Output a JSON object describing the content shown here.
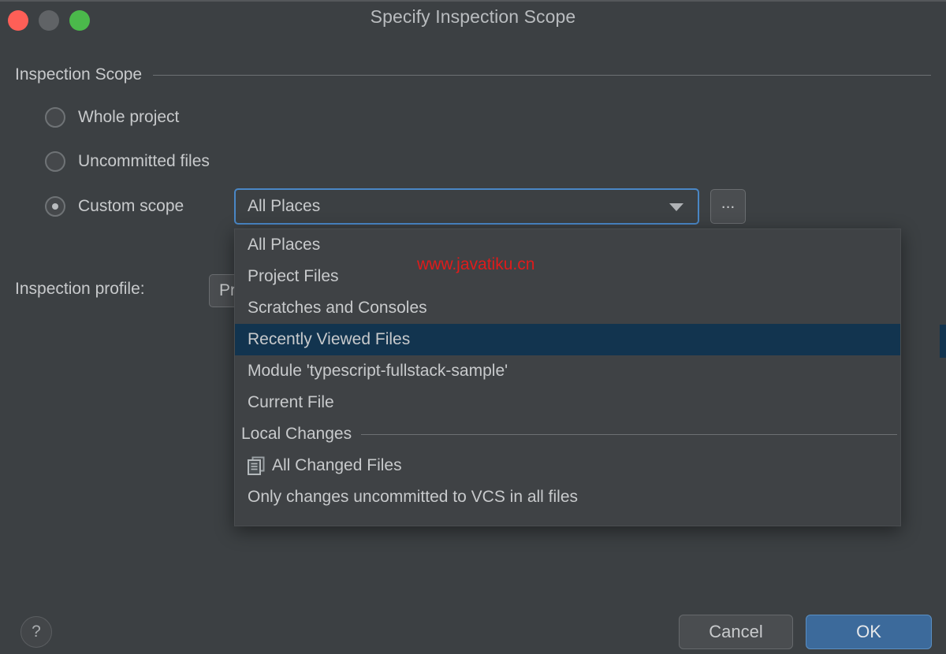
{
  "window": {
    "title": "Specify Inspection Scope",
    "controls": [
      {
        "name": "close",
        "color": "#ff5f57"
      },
      {
        "name": "minimize",
        "color": "#606366"
      },
      {
        "name": "maximize",
        "color": "#4bb94b"
      }
    ]
  },
  "section": {
    "header": "Inspection Scope"
  },
  "scope_options": [
    {
      "label": "Whole project",
      "checked": false
    },
    {
      "label": "Uncommitted files",
      "checked": false
    },
    {
      "label": "Custom scope",
      "checked": true
    }
  ],
  "scope_combo": {
    "value": "All Places",
    "arrow_icon": "chevron-down-icon",
    "focused": true
  },
  "ellipsis_button": {
    "label": "...",
    "icon": "ellipsis-icon"
  },
  "profile": {
    "label": "Inspection profile:",
    "value": "Pr"
  },
  "dropdown": {
    "items": [
      {
        "label": "All Places",
        "selected": false,
        "icon": null
      },
      {
        "label": "Project Files",
        "selected": false,
        "icon": null
      },
      {
        "label": "Scratches and Consoles",
        "selected": false,
        "icon": null
      },
      {
        "label": "Recently Viewed Files",
        "selected": true,
        "icon": null
      },
      {
        "label": "Module 'typescript-fullstack-sample'",
        "selected": false,
        "icon": null
      },
      {
        "label": "Current File",
        "selected": false,
        "icon": null
      }
    ],
    "group": {
      "label": "Local Changes"
    },
    "group_items": [
      {
        "label": "All Changed Files",
        "selected": false,
        "icon": "documents-icon"
      },
      {
        "label": "Only changes uncommitted to VCS in all files",
        "selected": false,
        "icon": null
      }
    ],
    "selected_color": "#12344f"
  },
  "watermark": {
    "text": "www.javatiku.cn",
    "color": "#e01b1b"
  },
  "footer": {
    "help_label": "?",
    "cancel_label": "Cancel",
    "ok_label": "OK",
    "ok_color": "#3c6a9b"
  }
}
